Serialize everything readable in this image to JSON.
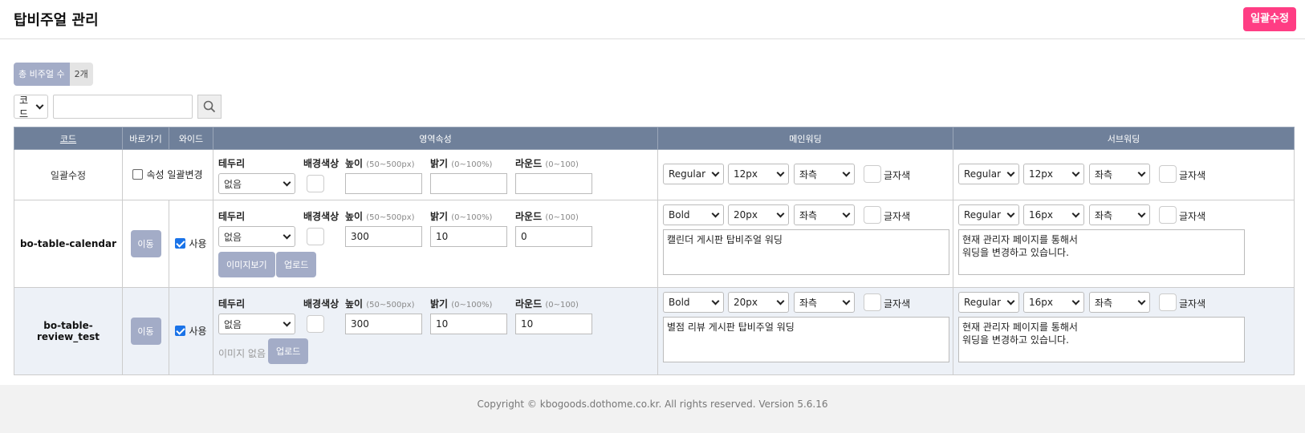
{
  "page": {
    "title": "탑비주얼 관리",
    "bulk_edit_label": "일괄수정"
  },
  "summary": {
    "total_label": "총 비주얼 수",
    "total_value": "2개"
  },
  "search": {
    "field_select": "코드",
    "query": ""
  },
  "table": {
    "headers": {
      "code": "코드",
      "shortcut": "바로가기",
      "wide": "와이드",
      "area": "영역속성",
      "main_wording": "메인워딩",
      "sub_wording": "서브워딩"
    },
    "labels": {
      "border": "테두리",
      "bg_color": "배경색상",
      "height": "높이",
      "height_hint": "(50~500px)",
      "brightness": "밝기",
      "brightness_hint": "(0~100%)",
      "round": "라운드",
      "round_hint": "(0~100)",
      "text_color": "글자색",
      "move": "이동",
      "use": "사용",
      "view_image": "이미지보기",
      "upload": "업로드",
      "no_image": "이미지 없음",
      "attr_bulk_change": "속성 일괄변경"
    },
    "rows": [
      {
        "code": "일괄수정",
        "attr_bulk_checked": false,
        "border": "없음",
        "height": "",
        "brightness": "",
        "round": "",
        "main": {
          "weight": "Regular",
          "size": "12px",
          "align": "좌측",
          "text": ""
        },
        "sub": {
          "weight": "Regular",
          "size": "12px",
          "align": "좌측",
          "text": ""
        }
      },
      {
        "code": "bo-table-calendar",
        "wide_checked": true,
        "border": "없음",
        "height": "300",
        "brightness": "10",
        "round": "0",
        "has_image": true,
        "main": {
          "weight": "Bold",
          "size": "20px",
          "align": "좌측",
          "text": "캘린더 게시판 탑비주얼 워딩"
        },
        "sub": {
          "weight": "Regular",
          "size": "16px",
          "align": "좌측",
          "text": "현재 관리자 페이지를 통해서\n워딩을 변경하고 있습니다."
        }
      },
      {
        "code": "bo-table-review_test",
        "wide_checked": true,
        "border": "없음",
        "height": "300",
        "brightness": "10",
        "round": "10",
        "has_image": false,
        "main": {
          "weight": "Bold",
          "size": "20px",
          "align": "좌측",
          "text": "별점 리뷰 게시판 탑비주얼 워딩"
        },
        "sub": {
          "weight": "Regular",
          "size": "16px",
          "align": "좌측",
          "text": "현재 관리자 페이지를 통해서\n워딩을 변경하고 있습니다."
        }
      }
    ]
  },
  "footer": {
    "text": "Copyright © kbogoods.dothome.co.kr. All rights reserved. Version 5.6.16"
  },
  "colors": {
    "accent_pink": "#ff3d84",
    "header_bg": "#6f809a",
    "button_gray": "#a3acc7",
    "row_alt_bg": "#edf1f7"
  }
}
